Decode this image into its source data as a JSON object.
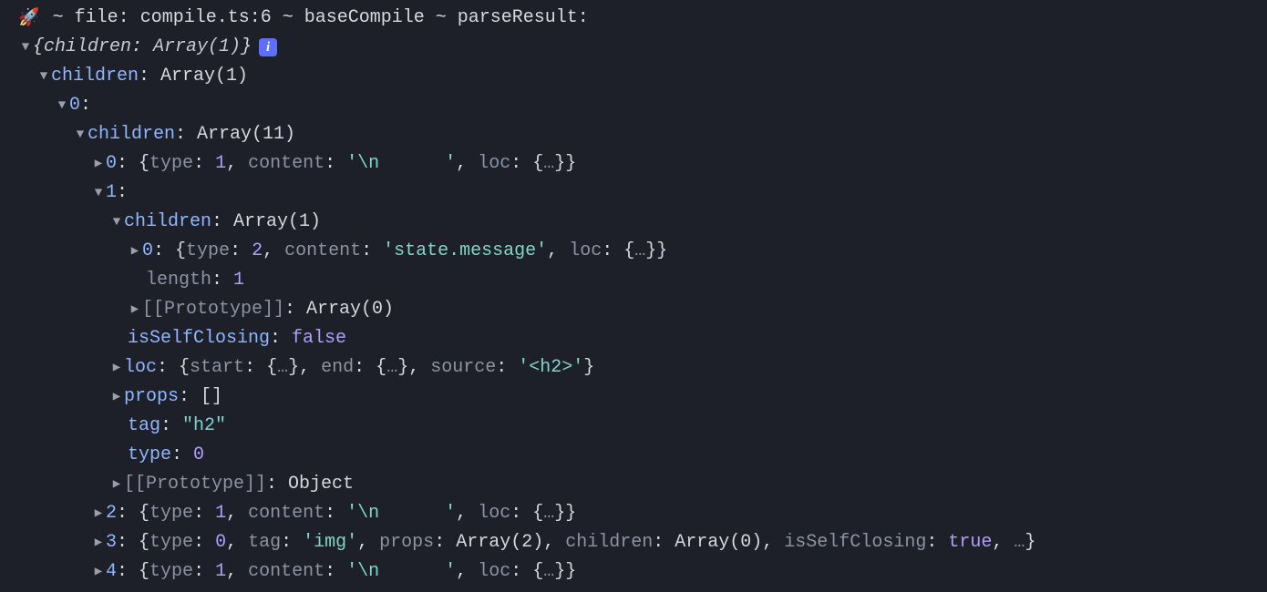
{
  "header": {
    "rocket": "🚀",
    "text": " ~ file: compile.ts:6 ~ baseCompile ~ parseResult:"
  },
  "root_summary": {
    "open": "{",
    "key": "children",
    "sep": ": ",
    "val": "Array(1)",
    "close": "}"
  },
  "info_badge": "i",
  "rows": {
    "children_top": {
      "key": "children",
      "sep": ": ",
      "val": "Array(1)"
    },
    "idx0_top": {
      "key": "0",
      "sep": ":"
    },
    "children_11": {
      "key": "children",
      "sep": ": ",
      "val": "Array(11)"
    },
    "arr0": {
      "key": "0",
      "sep": ": ",
      "brace_open": "{",
      "p1k": "type",
      "p1s": ": ",
      "p1v": "1",
      "c1": ", ",
      "p2k": "content",
      "p2s": ": ",
      "p2v": "'\\n      '",
      "c2": ", ",
      "p3k": "loc",
      "p3s": ": ",
      "p3v_open": "{",
      "p3v_ell": "…",
      "p3v_close": "}",
      "brace_close": "}"
    },
    "idx1": {
      "key": "1",
      "sep": ":"
    },
    "children_1": {
      "key": "children",
      "sep": ": ",
      "val": "Array(1)"
    },
    "inner0": {
      "key": "0",
      "sep": ": ",
      "brace_open": "{",
      "p1k": "type",
      "p1s": ": ",
      "p1v": "2",
      "c1": ", ",
      "p2k": "content",
      "p2s": ": ",
      "p2v": "'state.message'",
      "c2": ", ",
      "p3k": "loc",
      "p3s": ": ",
      "p3v_open": "{",
      "p3v_ell": "…",
      "p3v_close": "}",
      "brace_close": "}"
    },
    "length": {
      "key": "length",
      "sep": ": ",
      "val": "1"
    },
    "proto_arr": {
      "key": "[[Prototype]]",
      "sep": ": ",
      "val": "Array(0)"
    },
    "isSelfClosing": {
      "key": "isSelfClosing",
      "sep": ": ",
      "val": "false"
    },
    "loc": {
      "key": "loc",
      "sep": ": ",
      "brace_open": "{",
      "p1k": "start",
      "p1s": ": ",
      "p1v_open": "{",
      "p1v_ell": "…",
      "p1v_close": "}",
      "c1": ", ",
      "p2k": "end",
      "p2s": ": ",
      "p2v_open": "{",
      "p2v_ell": "…",
      "p2v_close": "}",
      "c2": ", ",
      "p3k": "source",
      "p3s": ": ",
      "p3v": "'<h2>'",
      "brace_close": "}"
    },
    "props": {
      "key": "props",
      "sep": ": ",
      "val": "[]"
    },
    "tag": {
      "key": "tag",
      "sep": ": ",
      "val": "\"h2\""
    },
    "type": {
      "key": "type",
      "sep": ": ",
      "val": "0"
    },
    "proto_obj": {
      "key": "[[Prototype]]",
      "sep": ": ",
      "val": "Object"
    },
    "arr2": {
      "key": "2",
      "sep": ": ",
      "brace_open": "{",
      "p1k": "type",
      "p1s": ": ",
      "p1v": "1",
      "c1": ", ",
      "p2k": "content",
      "p2s": ": ",
      "p2v": "'\\n      '",
      "c2": ", ",
      "p3k": "loc",
      "p3s": ": ",
      "p3v_open": "{",
      "p3v_ell": "…",
      "p3v_close": "}",
      "brace_close": "}"
    },
    "arr3": {
      "key": "3",
      "sep": ": ",
      "brace_open": "{",
      "p1k": "type",
      "p1s": ": ",
      "p1v": "0",
      "c1": ", ",
      "p2k": "tag",
      "p2s": ": ",
      "p2v": "'img'",
      "c2": ", ",
      "p3k": "props",
      "p3s": ": ",
      "p3v": "Array(2)",
      "c3": ", ",
      "p4k": "children",
      "p4s": ": ",
      "p4v": "Array(0)",
      "c4": ", ",
      "p5k": "isSelfClosing",
      "p5s": ": ",
      "p5v": "true",
      "c5": ", ",
      "ell": "…",
      "brace_close": "}"
    },
    "arr4": {
      "key": "4",
      "sep": ": ",
      "brace_open": "{",
      "p1k": "type",
      "p1s": ": ",
      "p1v": "1",
      "c1": ", ",
      "p2k": "content",
      "p2s": ": ",
      "p2v": "'\\n      '",
      "c2": ", ",
      "p3k": "loc",
      "p3s": ": ",
      "p3v_open": "{",
      "p3v_ell": "…",
      "p3v_close": "}",
      "brace_close": "}"
    }
  }
}
